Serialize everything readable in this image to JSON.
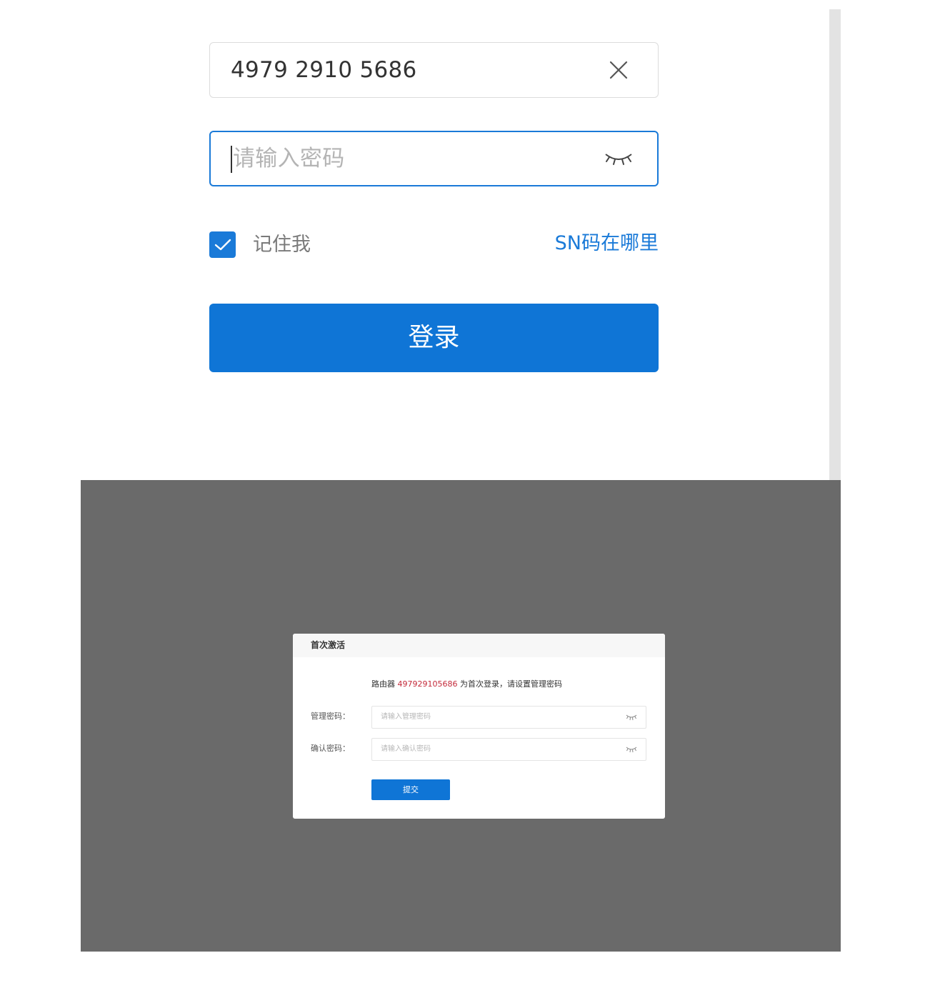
{
  "login_form": {
    "sn_value": "4979 2910 5686",
    "password_placeholder": "请输入密码",
    "remember_label": "记住我",
    "remember_checked": true,
    "sn_help_link": "SN码在哪里",
    "login_button": "登录"
  },
  "activation_dialog": {
    "title": "首次激活",
    "message_prefix": "路由器 ",
    "message_sn": "497929105686",
    "message_suffix": " 为首次登录，请设置管理密码",
    "admin_password_label": "管理密码：",
    "admin_password_placeholder": "请输入管理密码",
    "confirm_password_label": "确认密码：",
    "confirm_password_placeholder": "请输入确认密码",
    "submit_button": "提交"
  },
  "colors": {
    "accent": "#1a7ad8",
    "overlay": "#6a6a6a",
    "sn_highlight": "#c42a3a"
  },
  "icons": {
    "clear": "close-icon",
    "password_visibility": "eye-closed-icon",
    "checkbox": "checkmark-icon"
  }
}
